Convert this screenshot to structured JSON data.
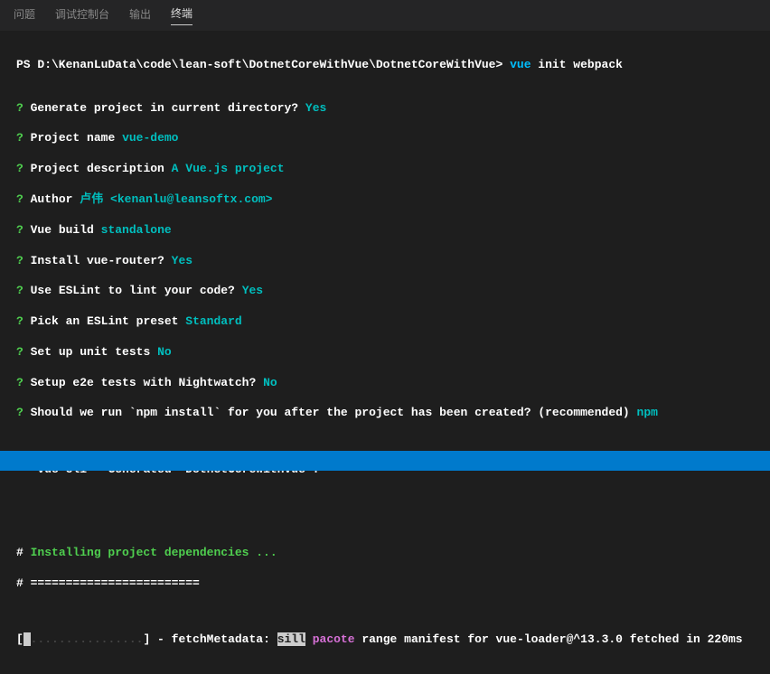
{
  "tabs": {
    "problems": "问题",
    "debugConsole": "调试控制台",
    "output": "输出",
    "terminal": "终端"
  },
  "promptPrefix": "PS D:\\KenanLuData\\code\\lean-soft\\DotnetCoreWithVue\\DotnetCoreWithVue> ",
  "command": "vue",
  "commandArgs": " init webpack",
  "questions": [
    {
      "q": "Generate project in current directory?",
      "a": "Yes"
    },
    {
      "q": "Project name",
      "a": "vue-demo"
    },
    {
      "q": "Project description",
      "a": "A Vue.js project"
    },
    {
      "q": "Author",
      "a": "卢伟 <kenanlu@leansoftx.com>"
    },
    {
      "q": "Vue build",
      "a": "standalone"
    },
    {
      "q": "Install vue-router?",
      "a": "Yes"
    },
    {
      "q": "Use ESLint to lint your code?",
      "a": "Yes"
    },
    {
      "q": "Pick an ESLint preset",
      "a": "Standard"
    },
    {
      "q": "Set up unit tests",
      "a": "No"
    },
    {
      "q": "Setup e2e tests with Nightwatch?",
      "a": "No"
    },
    {
      "q": "Should we run `npm install` for you after the project has been created? (recommended)",
      "a": "npm"
    }
  ],
  "generated": {
    "prefix": "   vue-cli ",
    "middle": "·",
    "suffix": " Generated \"DotnetCoreWithVue\"."
  },
  "installing": {
    "hash": "# ",
    "text": "Installing project dependencies ...",
    "divider": "# ========================"
  },
  "progress": {
    "openBracket": "[",
    "block": " ",
    "dots": "................",
    "closeBracket": "] - fetchMetadata: ",
    "sill": "sill",
    "space1": " ",
    "pacote": "pacote",
    "rest": " range manifest for vue-loader@^13.3.0 fetched in 220ms"
  }
}
